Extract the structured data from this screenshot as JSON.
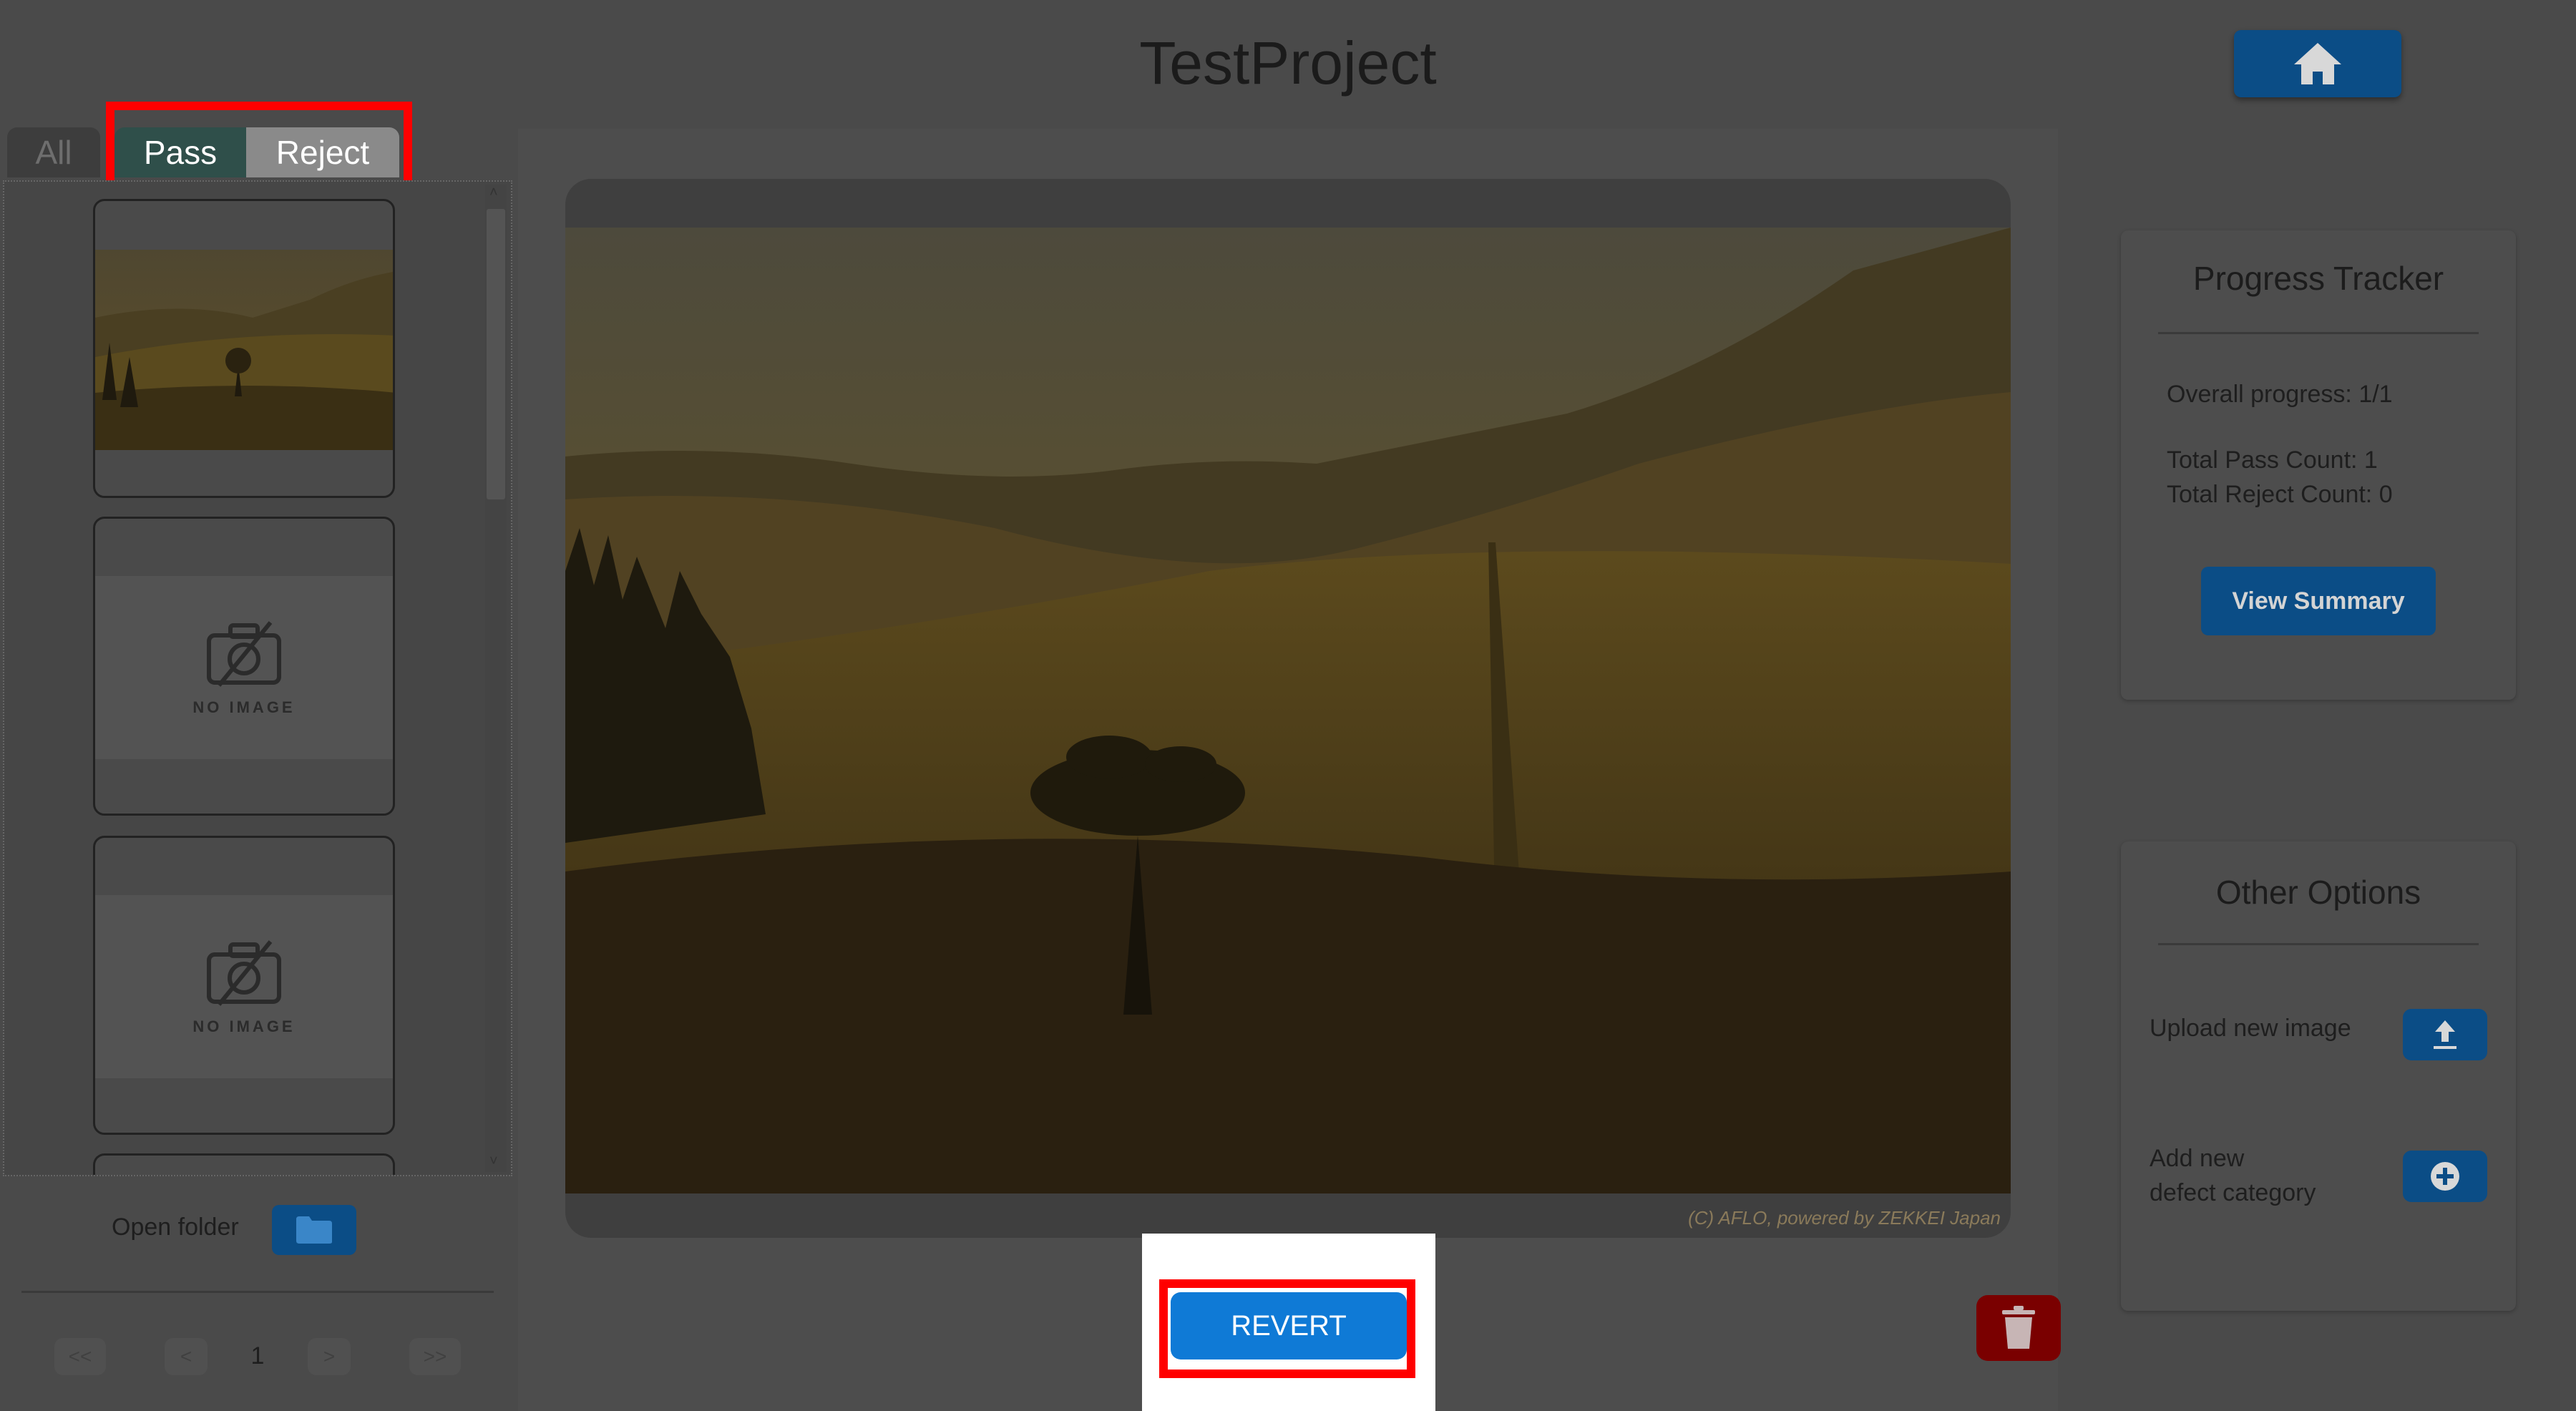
{
  "header": {
    "title": "TestProject",
    "home_icon": "home-icon"
  },
  "tabs": [
    {
      "label": "All",
      "state": "inactive"
    },
    {
      "label": "Pass",
      "state": "selected"
    },
    {
      "label": "Reject",
      "state": "inactive"
    }
  ],
  "thumbnails": [
    {
      "type": "image",
      "content": "landscape-thumbnail"
    },
    {
      "type": "placeholder",
      "label": "NO IMAGE"
    },
    {
      "type": "placeholder",
      "label": "NO IMAGE"
    }
  ],
  "sidebar": {
    "open_folder_label": "Open folder",
    "folder_icon": "folder-icon"
  },
  "pagination": {
    "first": "<<",
    "prev": "<",
    "page": "1",
    "next": ">",
    "last": ">>"
  },
  "viewer": {
    "credit": "(C) AFLO, powered by ZEKKEI Japan"
  },
  "actions": {
    "revert_label": "REVERT",
    "delete_icon": "trash-icon"
  },
  "progress_tracker": {
    "title": "Progress Tracker",
    "overall": "Overall progress: 1/1",
    "pass_count": "Total Pass Count: 1",
    "reject_count": "Total Reject Count: 0",
    "view_summary_label": "View Summary"
  },
  "other_options": {
    "title": "Other Options",
    "upload_label": "Upload new image",
    "add_defect_line1": "Add new",
    "add_defect_line2": "defect category",
    "upload_icon": "upload-icon",
    "add_icon": "plus-circle-icon"
  },
  "colors": {
    "primary_button": "#0f7ad6",
    "dark_button": "#0b4d86",
    "delete": "#7a0000",
    "highlight": "#ff0000",
    "pass_tab": "#2f4f4a"
  }
}
